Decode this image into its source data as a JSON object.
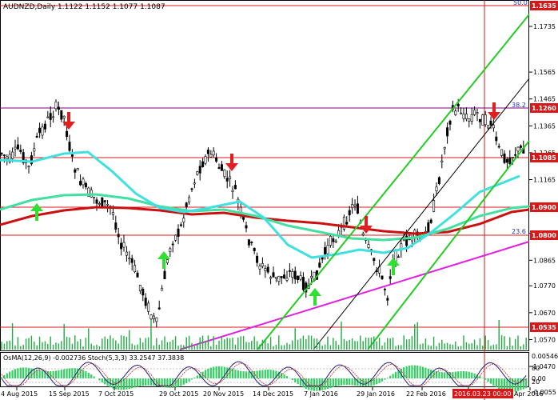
{
  "header": {
    "title": "AUDNZD,Daily",
    "values": "1.1122 1.1152 1.1077 1.1087"
  },
  "price_axis": {
    "ticks": [
      "1.1735",
      "1.1565",
      "1.1465",
      "1.1365",
      "1.1265",
      "1.1165",
      "1.1065",
      "1.0965",
      "1.0865",
      "1.0770",
      "1.0670",
      "1.0570",
      "1.0470"
    ]
  },
  "levels": [
    {
      "label": "1.1635",
      "color": "#d81818"
    },
    {
      "label": "1.1260",
      "color": "#d81818"
    },
    {
      "label": "1.1085",
      "color": "#d81818"
    },
    {
      "label": "1.0900",
      "color": "#d81818"
    },
    {
      "label": "1.0800",
      "color": "#d81818"
    },
    {
      "label": "1.0535",
      "color": "#d81818"
    }
  ],
  "fib_labels": {
    "top": "50.0",
    "mid": "38.2",
    "low": "23.6"
  },
  "oscillator": {
    "title": "OsMA(12,26,9) -0.002736  Stoch(5,3,3) 33.2547 37.3838",
    "ticks": [
      "0.00546",
      "0.00",
      "-0.0055"
    ],
    "stoch_levels": [
      "80",
      "20"
    ]
  },
  "time_axis": {
    "labels": [
      "4 Aug 2015",
      "15 Sep 2015",
      "7 Oct 2015",
      "29 Oct 2015",
      "20 Nov 2015",
      "14 Dec 2015",
      "7 Jan 2016",
      "29 Jan 2016",
      "22 Feb 2016",
      "2016.03.23 00:00",
      "Apr 2016"
    ]
  },
  "colors": {
    "price_line": "#d81818",
    "fib_line": "#800080",
    "channel": "#22cc22",
    "trendline": "#e020e0",
    "ma_cyan": "#40e0e0",
    "ma_red": "#cc1010",
    "ma_green": "#40e0a0",
    "arrow_down": "#e02020",
    "arrow_up": "#30e030",
    "histogram": "#30d060"
  }
}
